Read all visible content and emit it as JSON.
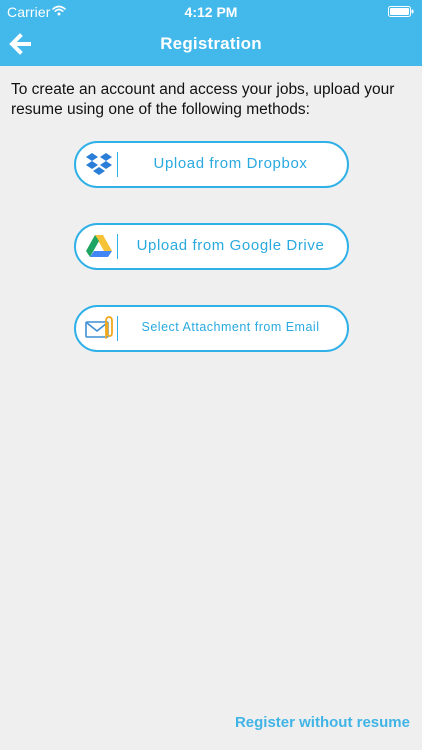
{
  "status_bar": {
    "carrier": "Carrier",
    "time": "4:12 PM"
  },
  "nav": {
    "title": "Registration",
    "back_icon": "arrow-left-icon"
  },
  "instructions": "To create an account and access your jobs, upload your resume using one of the following methods:",
  "upload_options": [
    {
      "label": "Upload from Dropbox",
      "icon": "dropbox-icon"
    },
    {
      "label": "Upload from Google Drive",
      "icon": "google-drive-icon"
    },
    {
      "label": "Select Attachment from Email",
      "icon": "email-attachment-icon"
    }
  ],
  "footer": {
    "register_label": "Register without resume"
  },
  "colors": {
    "header": "#43b8ea",
    "accent": "#2fb0e7",
    "background": "#efeff0"
  }
}
